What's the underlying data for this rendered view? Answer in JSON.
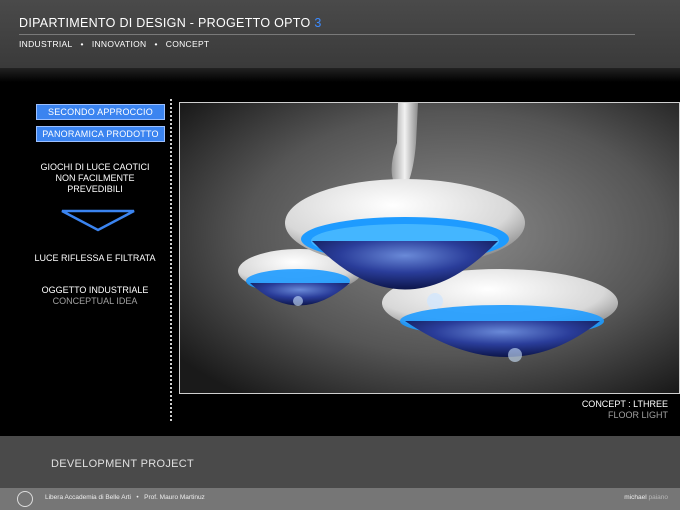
{
  "header": {
    "title": "DIPARTIMENTO DI DESIGN  -  PROGETTO OPTO",
    "title_number": "3",
    "nav": [
      "INDUSTRIAL",
      "INNOVATION",
      "CONCEPT"
    ]
  },
  "sidebar": {
    "button_1": "SECONDO APPROCCIO",
    "button_2": "PANORAMICA PRODOTTO",
    "text_1_line1": "GIOCHI DI LUCE CAOTICI",
    "text_1_line2": "NON FACILMENTE",
    "text_1_line3": "PREVEDIBILI",
    "text_2": "LUCE RIFLESSA E FILTRATA",
    "text_3": "OGGETTO INDUSTRIALE",
    "text_4": "CONCEPTUAL IDEA"
  },
  "caption": {
    "line1": "CONCEPT :   LTHREE",
    "line2": "FLOOR LIGHT"
  },
  "footer": {
    "title": "DEVELOPMENT PROJECT",
    "institution": "Libera Accademia di Belle Arti",
    "professor": "Prof. Mauro Martinuz",
    "author": "michael",
    "author_surname": "paiano"
  },
  "colors": {
    "accent": "#3b84f0",
    "header_bg": "#444444",
    "footer_bg": "#4a4a4a",
    "glow": "#1e9bff"
  },
  "icons": {
    "triangle": "triangle-down-icon",
    "logo": "academy-seal-icon"
  }
}
